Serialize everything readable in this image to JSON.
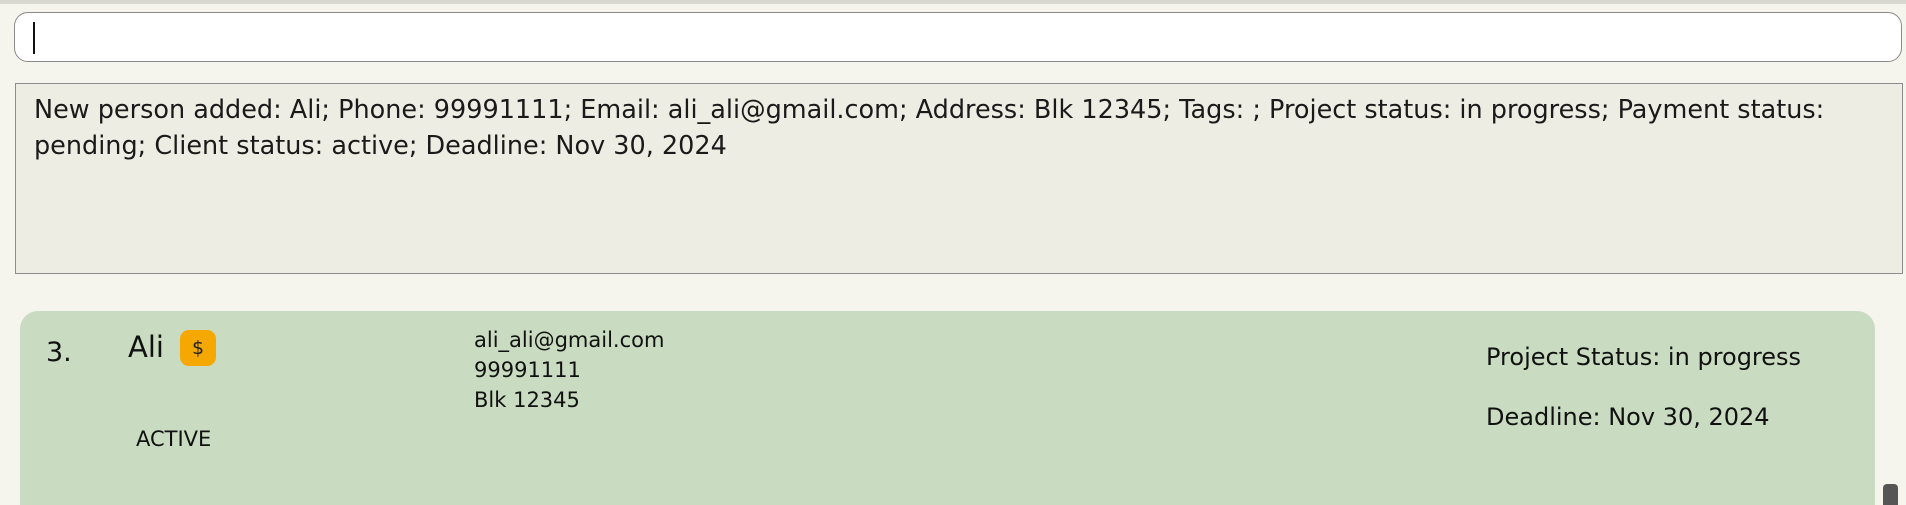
{
  "command": {
    "value": ""
  },
  "result": {
    "text": "New person added: Ali; Phone: 99991111; Email: ali_ali@gmail.com; Address: Blk 12345; Tags: ; Project status: in progress; Payment status: pending; Client status: active; Deadline: Nov 30, 2024"
  },
  "person": {
    "index": "3.",
    "name": "Ali",
    "payment_badge": "$",
    "client_status": "ACTIVE",
    "email": "ali_ali@gmail.com",
    "phone": "99991111",
    "address": "Blk 12345",
    "project_status": "Project Status: in progress",
    "deadline": "Deadline: Nov 30, 2024"
  },
  "colors": {
    "card_background": "#c9dbc0",
    "payment_badge": "#f5a800",
    "result_background": "#eeede4"
  }
}
